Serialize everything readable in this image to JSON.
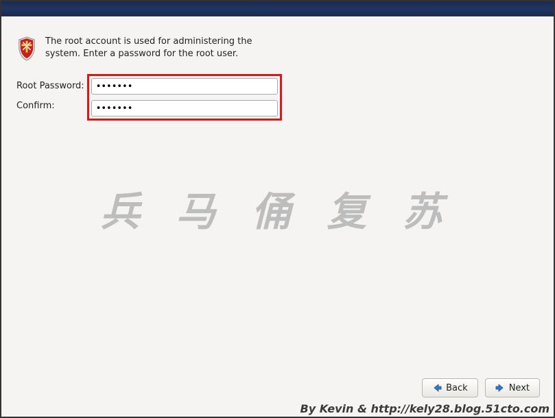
{
  "intro": {
    "text": "The root account is used for administering the system.  Enter a password for the root user."
  },
  "form": {
    "root_password_label": "Root Password:",
    "confirm_label": "Confirm:",
    "root_password_value": "•••••••",
    "confirm_value": "•••••••"
  },
  "buttons": {
    "back": "Back",
    "next": "Next"
  },
  "watermark": {
    "cn": "兵 马 俑 复 苏",
    "credit": "By Kevin & http://kely28.blog.51cto.com"
  }
}
